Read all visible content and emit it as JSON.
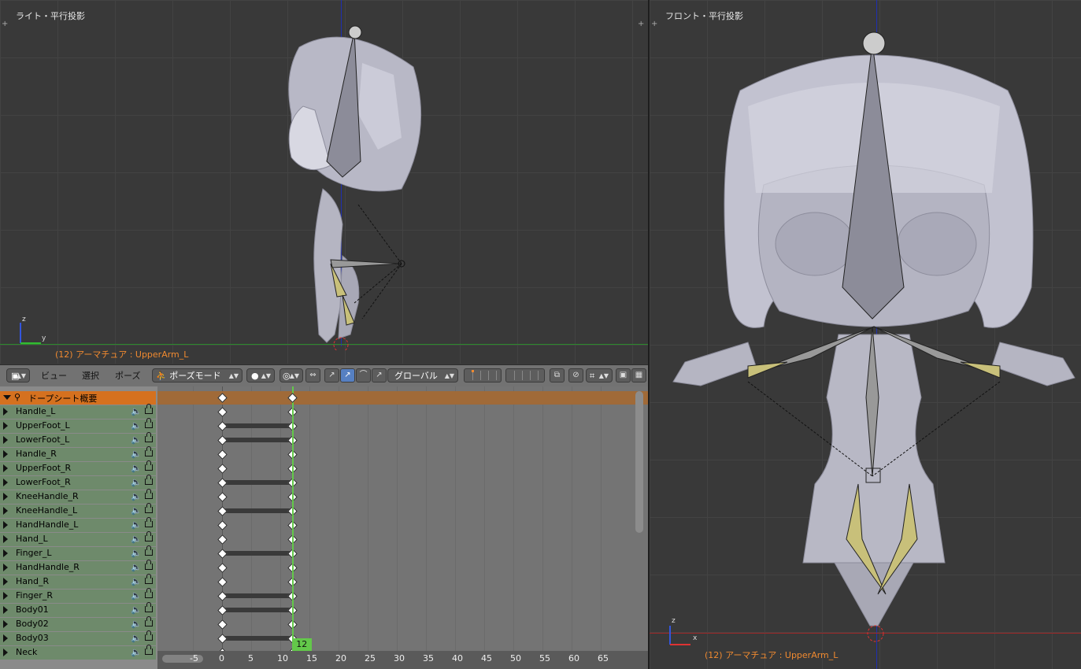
{
  "left_viewport": {
    "title": "ライト・平行投影",
    "status": "(12) アーマチュア : UpperArm_L",
    "axis_vertical": "z",
    "axis_horizontal": "y"
  },
  "right_viewport": {
    "title": "フロント・平行投影",
    "status": "(12) アーマチュア : UpperArm_L",
    "axis_vertical": "z",
    "axis_horizontal": "x"
  },
  "header": {
    "menu": [
      "ビュー",
      "選択",
      "ポーズ"
    ],
    "mode": "ポーズモード",
    "orientation": "グローバル"
  },
  "dopesheet": {
    "summary_label": "ドープシート概要",
    "channels": [
      {
        "name": "Handle_L",
        "hold": false
      },
      {
        "name": "UpperFoot_L",
        "hold": true
      },
      {
        "name": "LowerFoot_L",
        "hold": true
      },
      {
        "name": "Handle_R",
        "hold": false
      },
      {
        "name": "UpperFoot_R",
        "hold": false
      },
      {
        "name": "LowerFoot_R",
        "hold": true
      },
      {
        "name": "KneeHandle_R",
        "hold": false
      },
      {
        "name": "KneeHandle_L",
        "hold": true
      },
      {
        "name": "HandHandle_L",
        "hold": false
      },
      {
        "name": "Hand_L",
        "hold": false
      },
      {
        "name": "Finger_L",
        "hold": true
      },
      {
        "name": "HandHandle_R",
        "hold": false
      },
      {
        "name": "Hand_R",
        "hold": false
      },
      {
        "name": "Finger_R",
        "hold": true
      },
      {
        "name": "Body01",
        "hold": true
      },
      {
        "name": "Body02",
        "hold": false
      },
      {
        "name": "Body03",
        "hold": true
      },
      {
        "name": "Neck",
        "hold": false
      }
    ],
    "current_frame": "12",
    "keyframe_frames": [
      0,
      12
    ],
    "ruler_ticks": [
      "-5",
      "0",
      "5",
      "10",
      "15",
      "20",
      "25",
      "30",
      "35",
      "40",
      "45",
      "50",
      "55",
      "60",
      "65"
    ]
  },
  "colors": {
    "accent_orange": "#d5711f",
    "frame_green": "#63c84a",
    "status_text": "#f08a30"
  }
}
